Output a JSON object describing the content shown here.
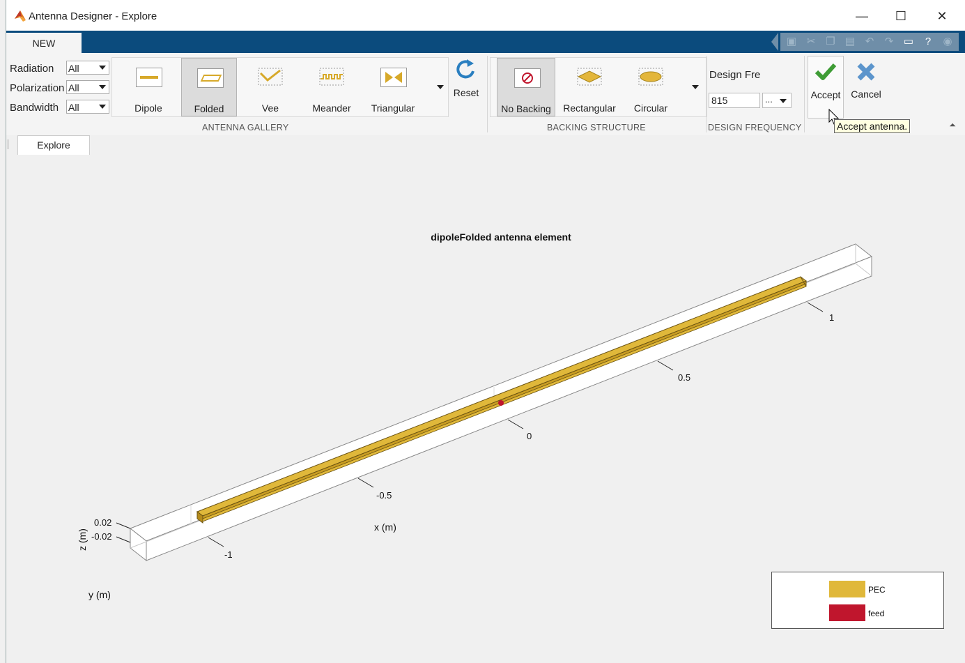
{
  "window": {
    "title": "Antenna Designer - Explore",
    "controls": {
      "minimize": "—",
      "maximize": "☐",
      "close": "✕"
    }
  },
  "tabs": {
    "new_tab": "NEW"
  },
  "filters": [
    {
      "label": "Radiation",
      "value": "All"
    },
    {
      "label": "Polarization",
      "value": "All"
    },
    {
      "label": "Bandwidth",
      "value": "All"
    }
  ],
  "antenna_gallery": {
    "section_label": "ANTENNA GALLERY",
    "items": [
      {
        "label": "Dipole",
        "icon": "dipole-icon",
        "selected": false
      },
      {
        "label": "Folded",
        "icon": "folded-dipole-icon",
        "selected": true
      },
      {
        "label": "Vee",
        "icon": "vee-icon",
        "selected": false
      },
      {
        "label": "Meander",
        "icon": "meander-icon",
        "selected": false
      },
      {
        "label": "Triangular",
        "icon": "triangular-icon",
        "selected": false
      }
    ]
  },
  "reset": {
    "label": "Reset"
  },
  "backing_structure": {
    "section_label": "BACKING STRUCTURE",
    "items": [
      {
        "label": "No Backing",
        "icon": "no-backing-icon",
        "selected": true
      },
      {
        "label": "Rectangular",
        "icon": "rectangular-backing-icon",
        "selected": false
      },
      {
        "label": "Circular",
        "icon": "circular-backing-icon",
        "selected": false
      }
    ]
  },
  "design_frequency": {
    "section_label": "DESIGN FREQUENCY",
    "label": "Design Fre",
    "value": "815",
    "unit_select": "..."
  },
  "actions": {
    "accept": "Accept",
    "cancel": "Cancel"
  },
  "tooltip": {
    "text": "Accept antenna."
  },
  "doc_tabs": {
    "explore": "Explore"
  },
  "plot": {
    "title": "dipoleFolded antenna element",
    "x_label": "x (m)",
    "y_label": "y (m)",
    "z_label": "z (m)",
    "x_ticks": [
      "-1",
      "-0.5",
      "0",
      "0.5",
      "1"
    ],
    "z_ticks": [
      "0.02",
      "-0.02"
    ],
    "colors": {
      "pec": "#e0b83a",
      "feed": "#c0162d"
    }
  },
  "legend": {
    "items": [
      {
        "label": "PEC",
        "color": "#e0b83a"
      },
      {
        "label": "feed",
        "color": "#c0162d"
      }
    ]
  }
}
